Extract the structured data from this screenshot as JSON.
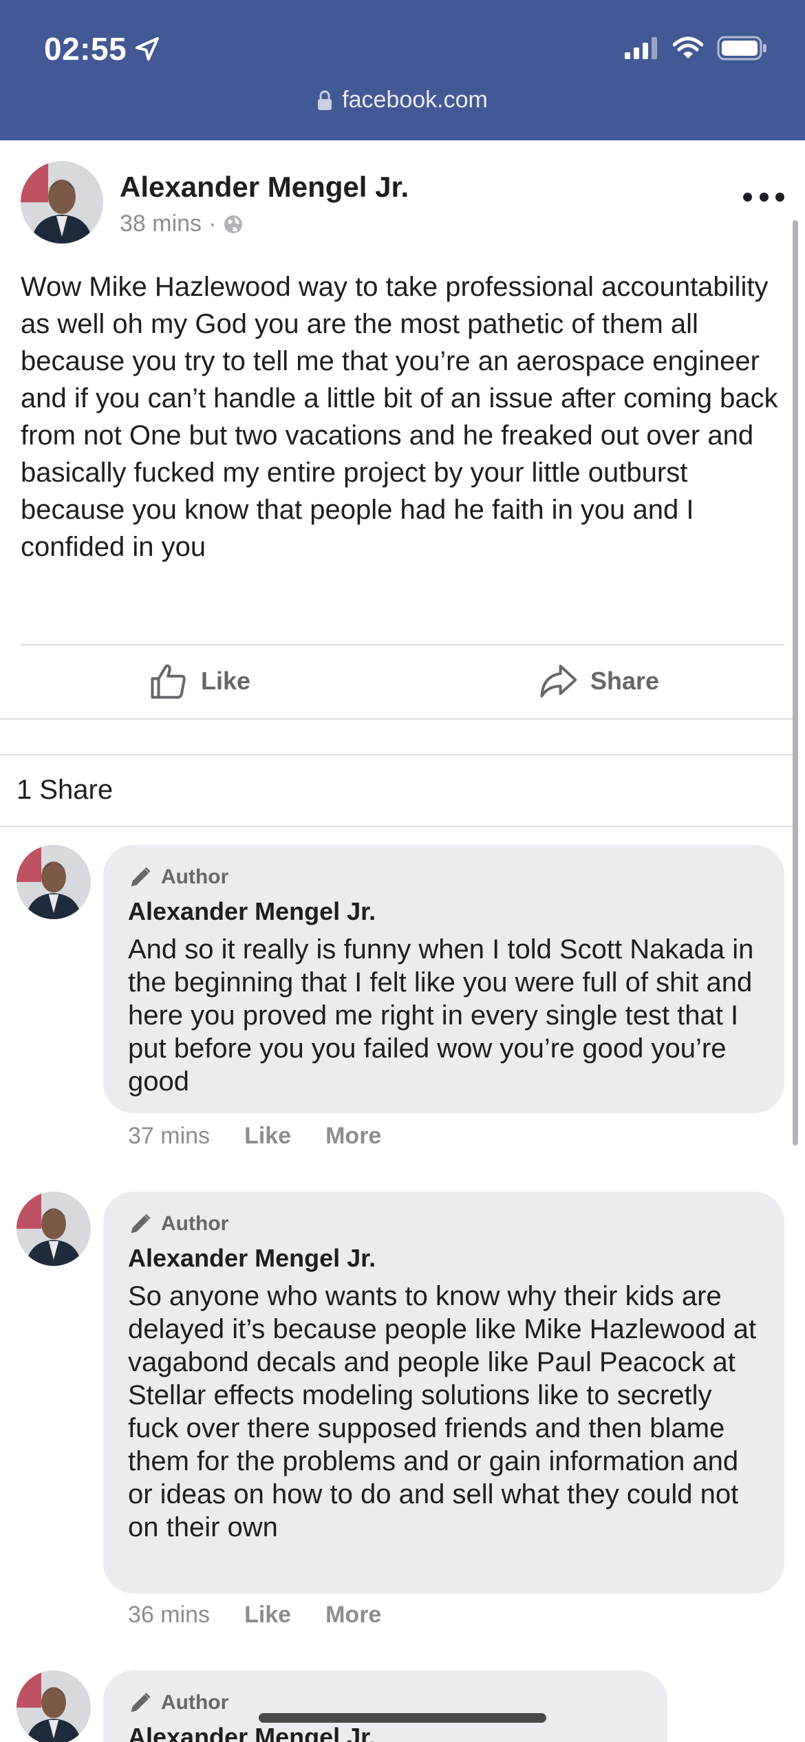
{
  "status_bar": {
    "time": "02:55",
    "url": "facebook.com"
  },
  "post": {
    "author": "Alexander Mengel Jr.",
    "time": "38 mins",
    "separator": "·",
    "text": "Wow Mike Hazlewood way to take professional accountability as well oh my God you are the most pathetic of them all because you try to tell me that you’re an aerospace engineer and if you can’t handle a little bit of an issue after coming back from not One but two vacations and he freaked out over and basically fucked my entire project by your little outburst because you know that people had he faith in you and I confided in you",
    "like_label": "Like",
    "share_label": "Share",
    "shares_count": "1 Share"
  },
  "comments": [
    {
      "badge": "Author",
      "name": "Alexander Mengel Jr.",
      "text": "And so it really is funny when I told Scott Nakada in the beginning that I felt like you were full of shit and here you proved me right in every single test that I put before you you failed wow you’re good you’re good",
      "time": "37 mins",
      "like": "Like",
      "more": "More"
    },
    {
      "badge": "Author",
      "name": "Alexander Mengel Jr.",
      "text": "So anyone who wants to know why their kids are delayed it’s because people like Mike Hazlewood at vagabond decals and people like Paul Peacock at Stellar effects modeling solutions like to secretly fuck over there supposed friends and then blame them for the problems and or gain information and or ideas on how to do and sell what they could not on their own",
      "time": "36 mins",
      "like": "Like",
      "more": "More"
    },
    {
      "badge": "Author",
      "name": "Alexander Mengel Jr."
    }
  ],
  "colors": {
    "header_bg": "#435995",
    "bubble_bg": "#ebecef",
    "muted_text": "#8a8d91"
  },
  "icons": [
    "location-arrow-icon",
    "signal-icon",
    "wifi-icon",
    "battery-icon",
    "lock-icon",
    "globe-icon",
    "more-dots-icon",
    "thumbs-up-icon",
    "share-arrow-icon",
    "pencil-icon"
  ]
}
